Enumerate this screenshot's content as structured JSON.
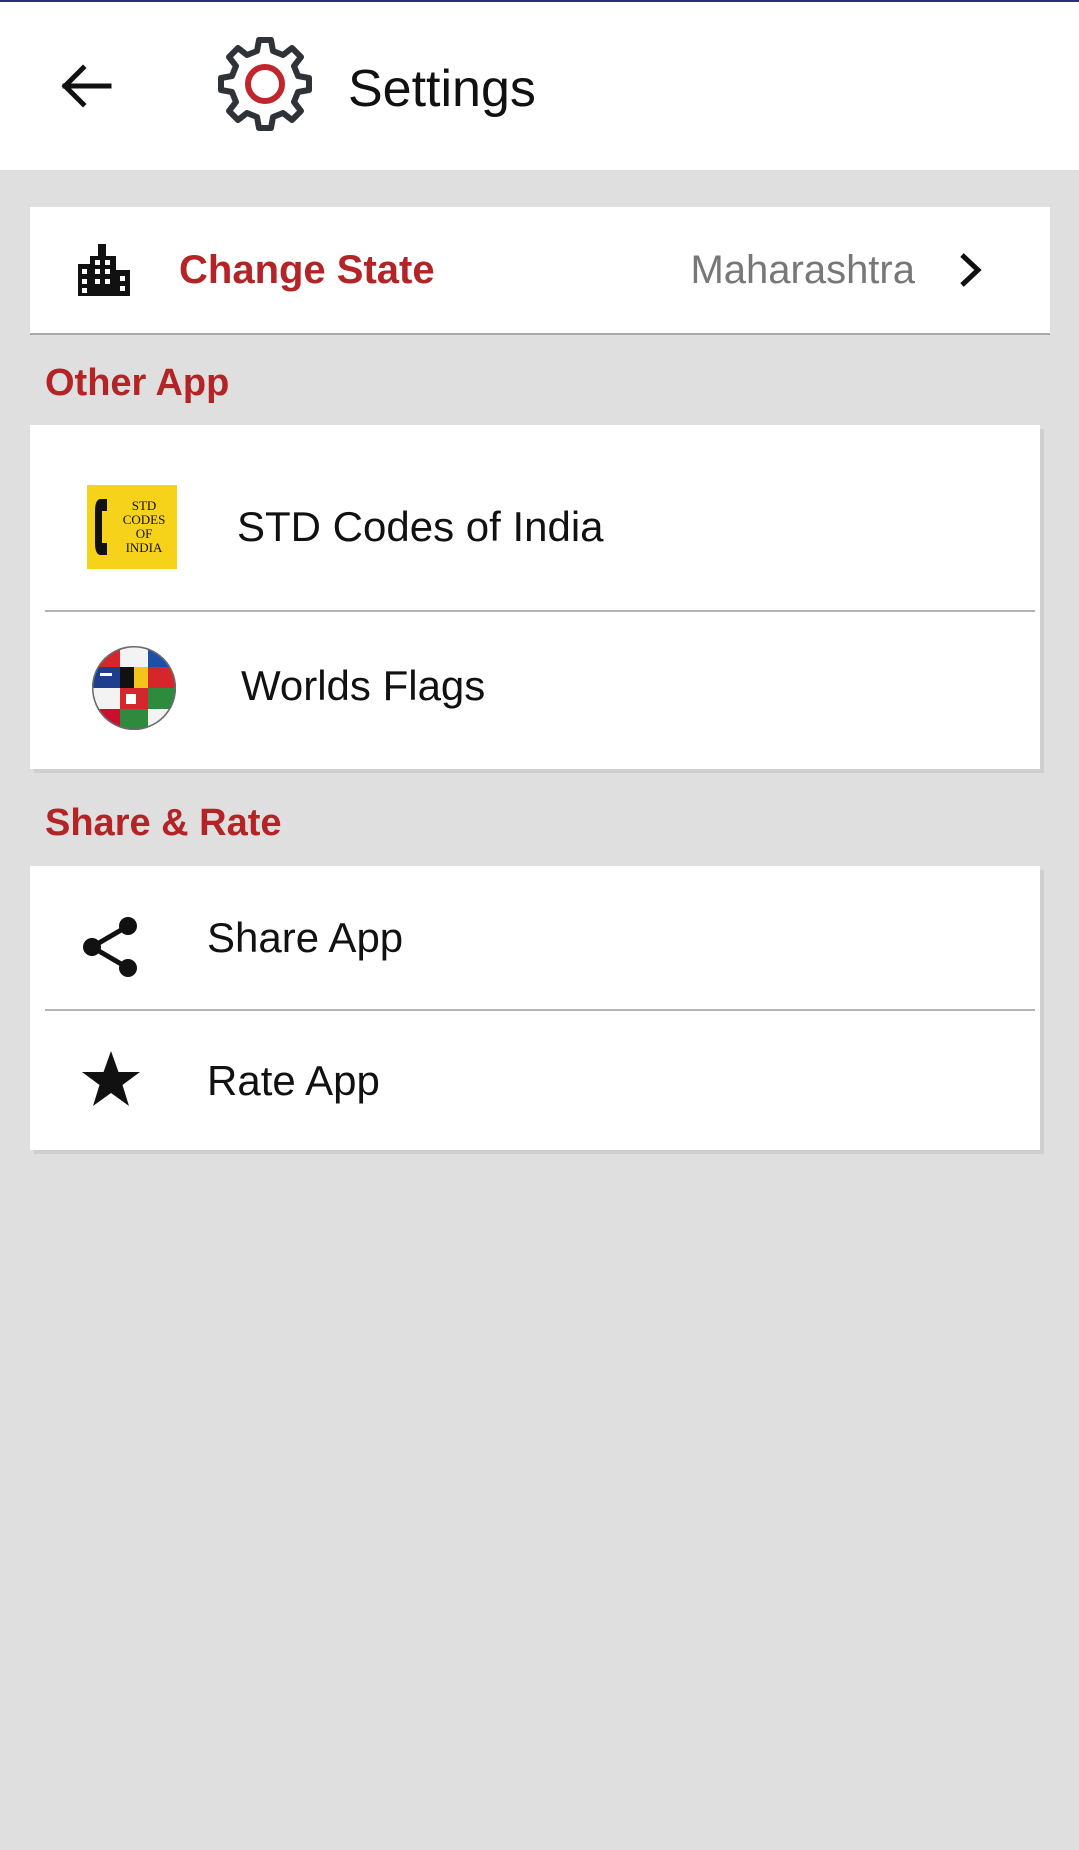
{
  "app_bar": {
    "title": "Settings",
    "back_icon": "arrow-back-icon",
    "logo_icon": "gear-icon"
  },
  "state_setting": {
    "icon": "city-buildings-icon",
    "label": "Change State",
    "value": "Maharashtra",
    "chevron_icon": "chevron-right-icon"
  },
  "other_apps": {
    "title": "Other App",
    "items": [
      {
        "label": "STD Codes of India",
        "icon": "std-codes-app-icon",
        "icon_text": [
          "STD",
          "CODES",
          "OF",
          "INDIA"
        ]
      },
      {
        "label": "Worlds Flags",
        "icon": "world-flags-globe-icon"
      }
    ]
  },
  "share_rate": {
    "title": "Share & Rate",
    "items": [
      {
        "label": "Share App",
        "icon": "share-icon"
      },
      {
        "label": "Rate App",
        "icon": "star-icon"
      }
    ]
  },
  "colors": {
    "accent": "#b42325",
    "background": "#dfdfdf",
    "card": "#ffffff",
    "secondary_text": "#777777",
    "status_line": "#2b2f7a"
  }
}
